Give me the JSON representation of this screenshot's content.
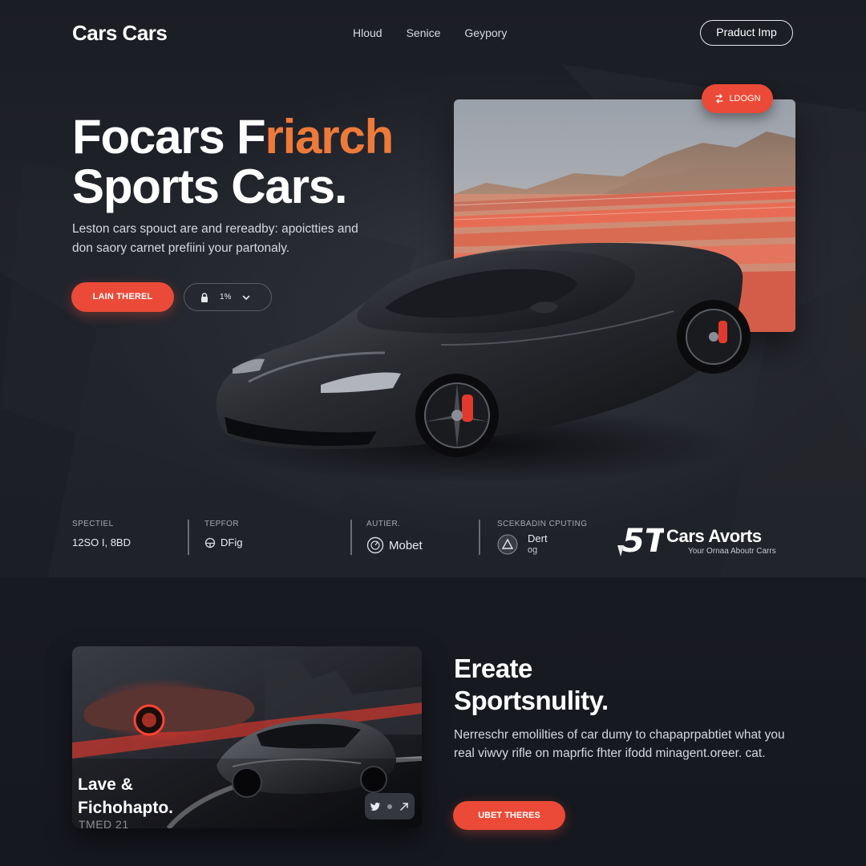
{
  "nav": {
    "logo": "Cars Cars",
    "links": [
      "Hloud",
      "Senice",
      "Geypory"
    ],
    "cta": "Praduct Imp"
  },
  "hero": {
    "headline_white": "Focars F",
    "headline_accent": "riarch",
    "headline_line2": "Sports Cars.",
    "desc_line1": "Leston cars spouct are and rereadby: apoictties and",
    "desc_line2": "don saory carnet prefiini your partonaly.",
    "primary_button": "LAIN THEREL",
    "secondary_text": "1%",
    "image_badge": "LDOGN",
    "accent_color": "#ee7a3a",
    "button_color": "#ea4a37"
  },
  "stats": [
    {
      "label": "SPECTIEL",
      "value": "12SO I, 8BD",
      "icon": ""
    },
    {
      "label": "TEPFOR",
      "value": "DFig",
      "icon": "steering-icon"
    },
    {
      "label": "AUTIER.",
      "value": "Mobet",
      "icon": "gauge-icon"
    },
    {
      "label": "SCEKBADIN CPUTING",
      "value": "Dert",
      "value2": "og",
      "icon": "shield-icon"
    }
  ],
  "brand": {
    "mark": "5T",
    "name": "Cars Avorts",
    "tagline": "Your Ornaa Aboutr Carrs"
  },
  "lower": {
    "card_title_line1": "Lave &",
    "card_title_line2": "Fichohapto.",
    "card_sub": "TMED 21",
    "heading_line1": "Ereate",
    "heading_line2": "Sportsnulity.",
    "desc": "Nerreschr emolilties of car dumy to chapaprpabtiet what you real viwvy rifle on maprfic fhter ifodd minagent.oreer. cat.",
    "button": "UBET THERES"
  }
}
